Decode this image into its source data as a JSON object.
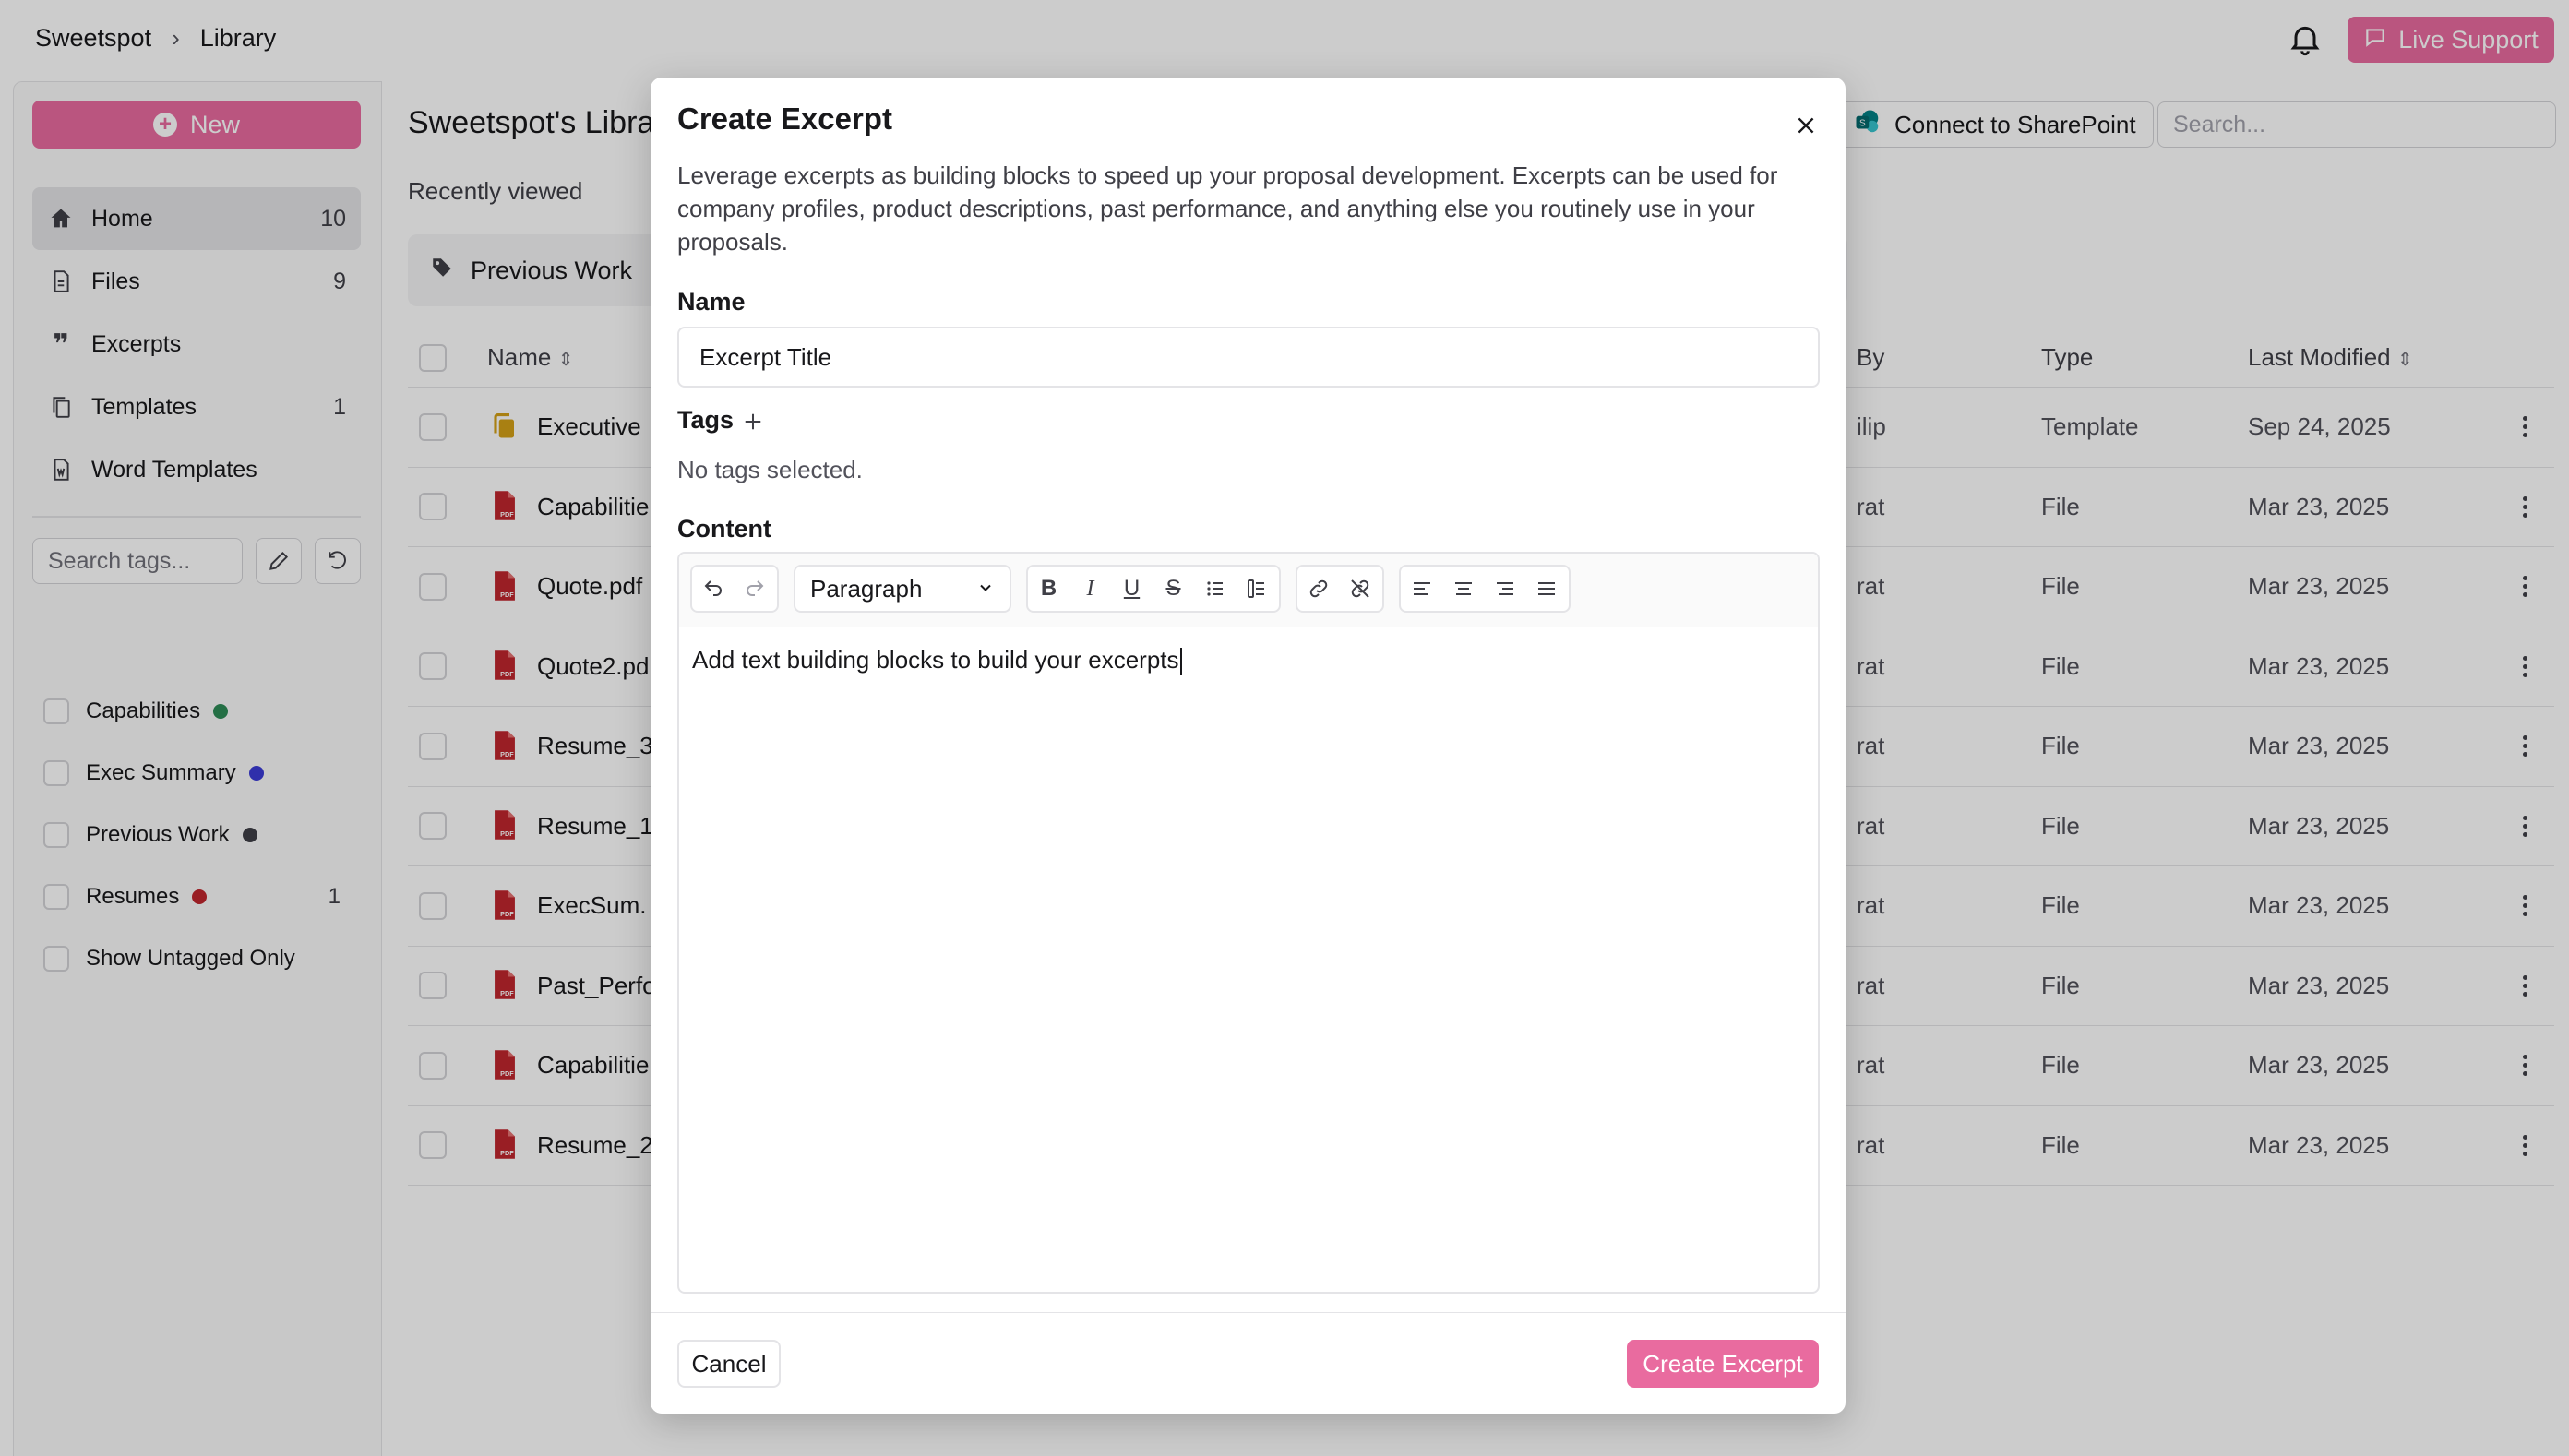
{
  "breadcrumb": {
    "root": "Sweetspot",
    "current": "Library"
  },
  "header": {
    "live_support": "Live Support"
  },
  "sidebar": {
    "new_label": "New",
    "nav": [
      {
        "label": "Home",
        "count": "10",
        "icon": "home-icon"
      },
      {
        "label": "Files",
        "count": "9",
        "icon": "file-icon"
      },
      {
        "label": "Excerpts",
        "count": "",
        "icon": "quote-icon"
      },
      {
        "label": "Templates",
        "count": "1",
        "icon": "copy-icon"
      },
      {
        "label": "Word Templates",
        "count": "",
        "icon": "word-file-icon"
      }
    ],
    "tag_search_placeholder": "Search tags...",
    "tags": [
      {
        "label": "Capabilities",
        "color": "#2e8b57",
        "count": ""
      },
      {
        "label": "Exec Summary",
        "color": "#3b3bd6",
        "count": ""
      },
      {
        "label": "Previous Work",
        "color": "#3f3f46",
        "count": ""
      },
      {
        "label": "Resumes",
        "color": "#c0262d",
        "count": "1"
      }
    ],
    "untagged_label": "Show Untagged Only"
  },
  "main": {
    "title": "Sweetspot's Library",
    "sharepoint_label": "Connect to SharePoint",
    "search_placeholder": "Search...",
    "recent_label": "Recently viewed",
    "recent_card": "Previous Work",
    "columns": {
      "name": "Name",
      "by": "By",
      "type": "Type",
      "modified": "Last Modified"
    },
    "rows": [
      {
        "name": "Executive",
        "by": "ilip",
        "type": "Template",
        "modified": "Sep 24, 2025",
        "kind": "template"
      },
      {
        "name": "Capabilitie",
        "by": "rat",
        "type": "File",
        "modified": "Mar 23, 2025",
        "kind": "pdf"
      },
      {
        "name": "Quote.pdf",
        "by": "rat",
        "type": "File",
        "modified": "Mar 23, 2025",
        "kind": "pdf"
      },
      {
        "name": "Quote2.pd",
        "by": "rat",
        "type": "File",
        "modified": "Mar 23, 2025",
        "kind": "pdf"
      },
      {
        "name": "Resume_3",
        "by": "rat",
        "type": "File",
        "modified": "Mar 23, 2025",
        "kind": "pdf"
      },
      {
        "name": "Resume_1.",
        "by": "rat",
        "type": "File",
        "modified": "Mar 23, 2025",
        "kind": "pdf"
      },
      {
        "name": "ExecSum.",
        "by": "rat",
        "type": "File",
        "modified": "Mar 23, 2025",
        "kind": "pdf"
      },
      {
        "name": "Past_Perfo",
        "by": "rat",
        "type": "File",
        "modified": "Mar 23, 2025",
        "kind": "pdf"
      },
      {
        "name": "Capabilitie",
        "by": "rat",
        "type": "File",
        "modified": "Mar 23, 2025",
        "kind": "pdf"
      },
      {
        "name": "Resume_2",
        "by": "rat",
        "type": "File",
        "modified": "Mar 23, 2025",
        "kind": "pdf"
      }
    ]
  },
  "modal": {
    "title": "Create Excerpt",
    "description": "Leverage excerpts as building blocks to speed up your proposal development. Excerpts can be used for company profiles, product descriptions, past performance, and anything else you routinely use in your proposals.",
    "name_label": "Name",
    "name_value": "Excerpt Title",
    "tags_label": "Tags",
    "no_tags": "No tags selected.",
    "content_label": "Content",
    "paragraph_select": "Paragraph",
    "editor_text": "Add text building blocks to build your excerpts",
    "cancel_label": "Cancel",
    "create_label": "Create Excerpt"
  },
  "colors": {
    "accent": "#e96b9f",
    "pdf": "#c0262d",
    "template": "#d4a017"
  }
}
